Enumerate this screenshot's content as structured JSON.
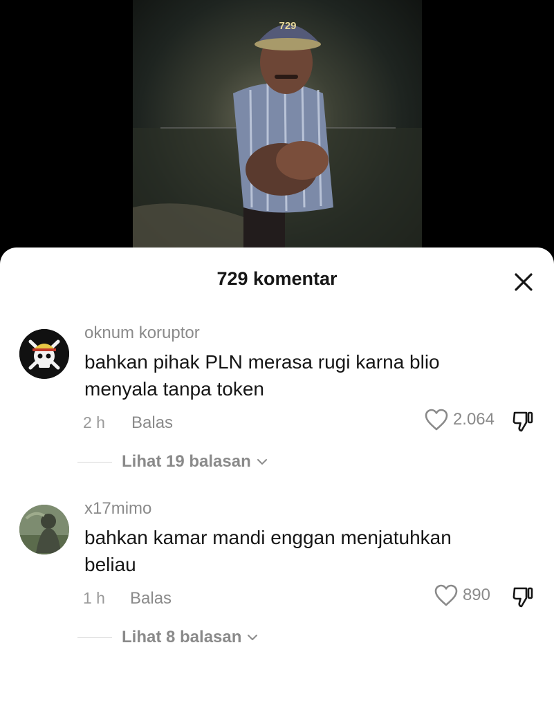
{
  "video": {
    "cap_text": "729"
  },
  "sheet": {
    "title": "729 komentar"
  },
  "comments": [
    {
      "username": "oknum koruptor",
      "text_line1": "bahkan pihak PLN merasa rugi karna blio",
      "text_line2": "menyala tanpa token",
      "time": "2 h",
      "reply_label": "Balas",
      "likes": "2.064",
      "view_replies": "Lihat 19 balasan"
    },
    {
      "username": "x17mimo",
      "text_line1": "bahkan kamar mandi enggan menjatuhkan",
      "text_line2": "beliau",
      "time": "1 h",
      "reply_label": "Balas",
      "likes": "890",
      "view_replies": "Lihat 8 balasan"
    }
  ],
  "icons": {
    "close": "close-icon",
    "heart": "heart-icon",
    "dislike": "thumbs-down-icon",
    "chevron": "chevron-down-icon"
  }
}
